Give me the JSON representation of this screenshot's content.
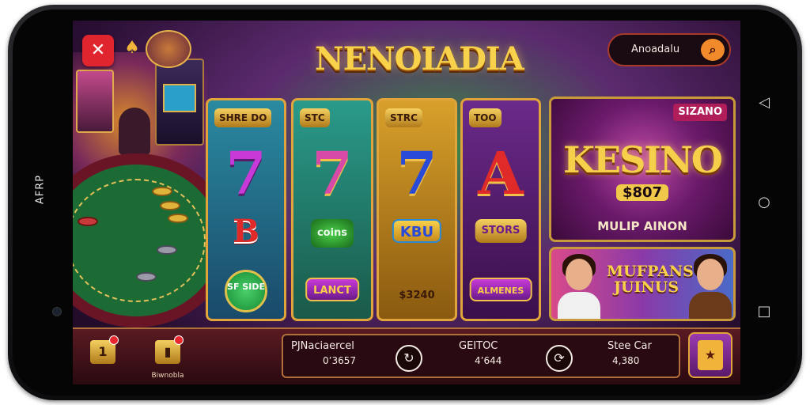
{
  "device": {
    "side_label": "AFRP",
    "nav": {
      "back_icon": "back-triangle-icon",
      "home_icon": "home-circle-icon",
      "recents_icon": "recents-square-icon"
    }
  },
  "header": {
    "close_icon": "close-x-icon",
    "title": "NENOIADIA",
    "search": {
      "placeholder": "Anoadalu",
      "icon": "search-icon"
    }
  },
  "reels": [
    {
      "label": "SHRE DO",
      "symbols": [
        "7",
        "B",
        "SF SIDE"
      ]
    },
    {
      "label": "STC",
      "symbols": [
        "7",
        "coins",
        "LANCT"
      ]
    },
    {
      "label": "STRC",
      "symbols": [
        "7",
        "KBU",
        "$3240"
      ]
    },
    {
      "label": "TOO",
      "symbols": [
        "A",
        "STORS",
        "ALMENES"
      ]
    }
  ],
  "promo_main": {
    "badge": "SIZANO",
    "title": "KESINO",
    "amount": "$807",
    "subtitle": "MULIP AINON"
  },
  "promo_secondary": {
    "title": "MUFPANS JUINUS"
  },
  "bottom_bar": {
    "left_icon_1": {
      "glyph": "1",
      "icon": "trophy-icon"
    },
    "left_icon_2": {
      "glyph": "▮",
      "label": "Biwnobla",
      "icon": "phone-icon"
    },
    "stats": [
      {
        "label": "PJNaciaercel",
        "value": "0’3657"
      },
      {
        "label": "GEITOC",
        "value": "4’644"
      },
      {
        "label": "Stee Car",
        "value": "4,380"
      }
    ],
    "corner_icon": "bonus-box-icon"
  },
  "colors": {
    "accent": "#f8d24a",
    "danger": "#e0252e",
    "frame": "#e0a43a"
  }
}
